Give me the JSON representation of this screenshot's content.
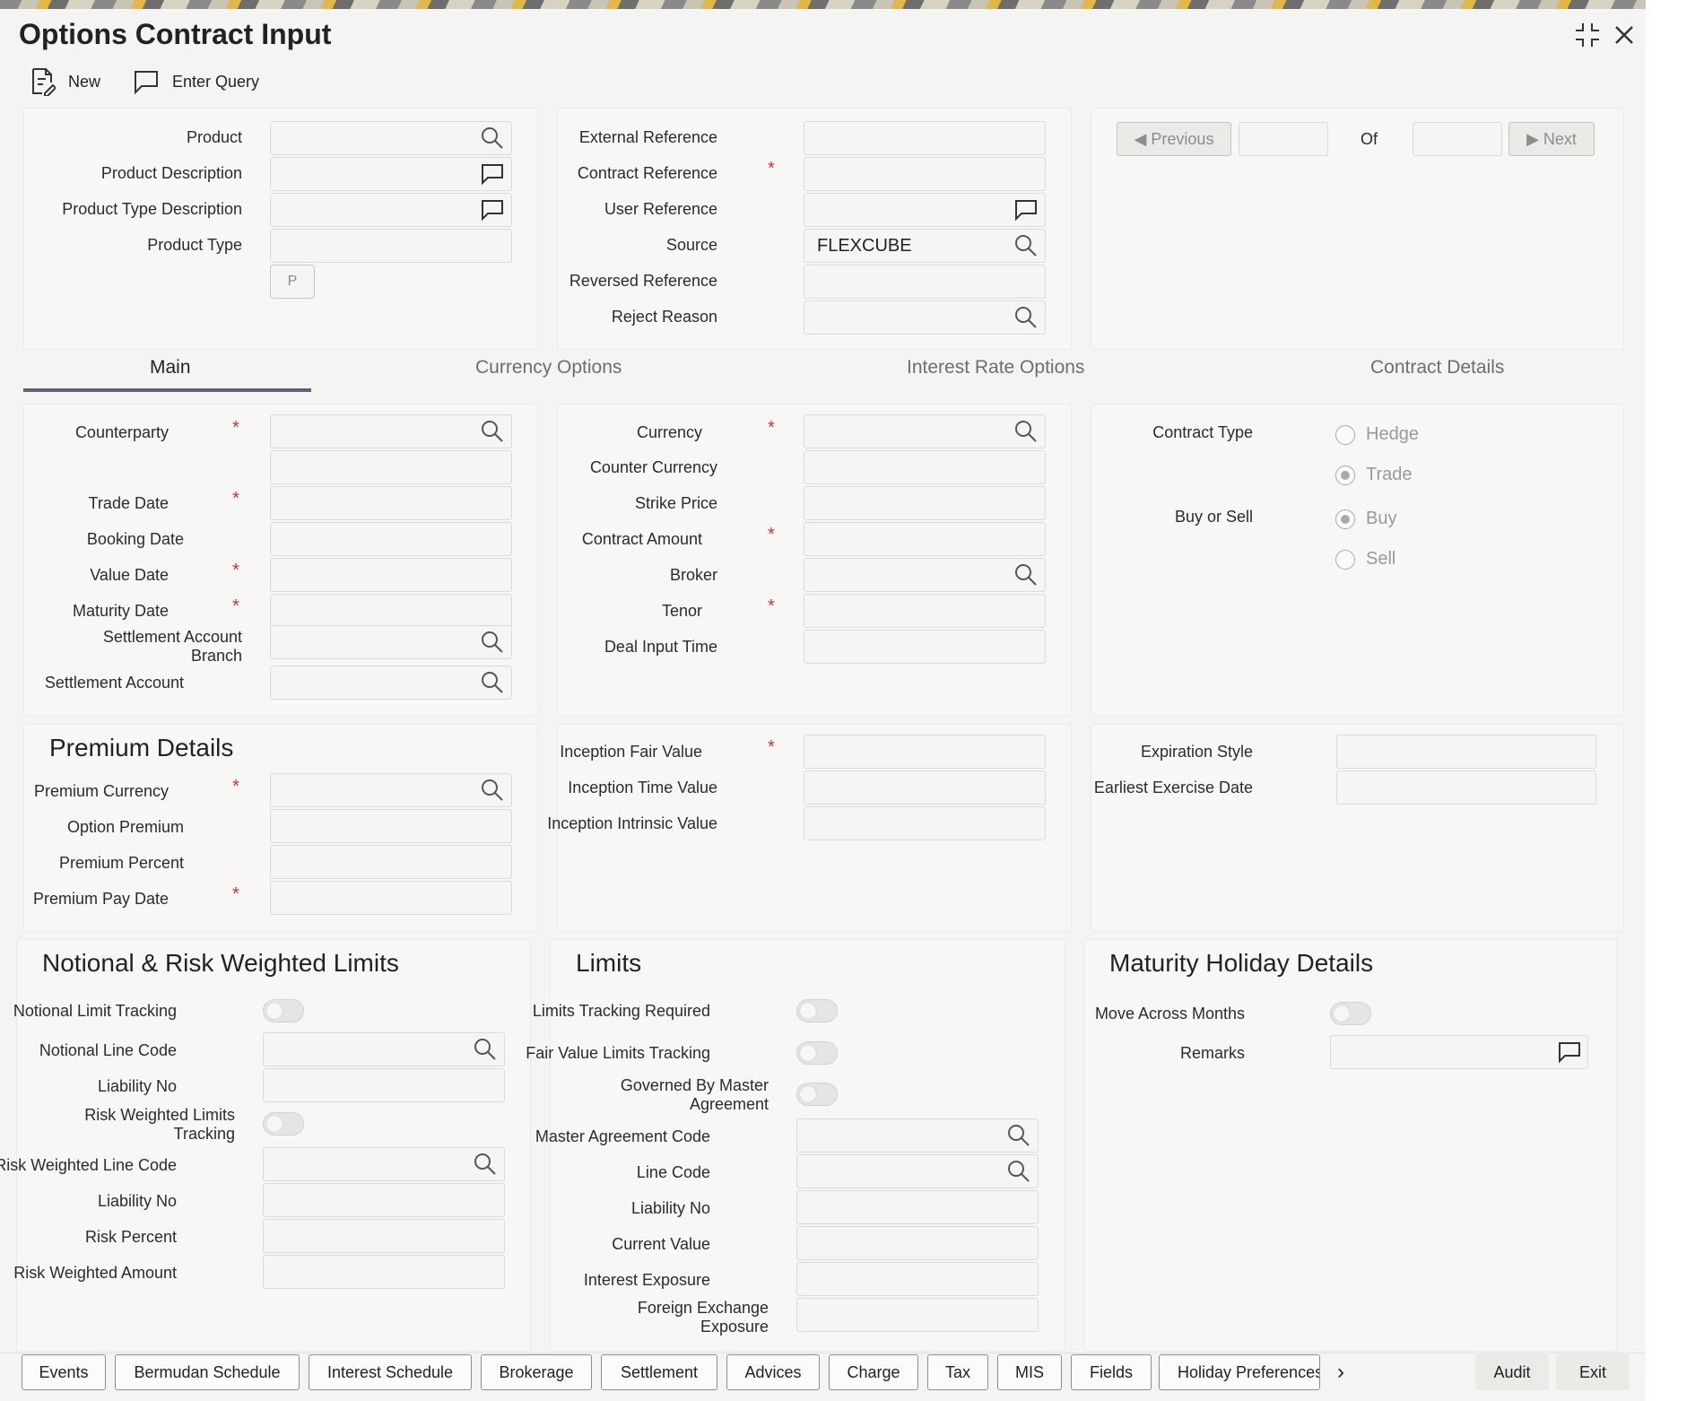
{
  "window": {
    "title": "Options Contract Input"
  },
  "toolbar": {
    "new_label": "New",
    "enter_query_label": "Enter Query"
  },
  "header": {
    "product_label": "Product",
    "product_description_label": "Product Description",
    "product_type_description_label": "Product Type Description",
    "product_type_label": "Product Type",
    "p_button": "P",
    "external_reference_label": "External Reference",
    "contract_reference_label": "Contract Reference",
    "user_reference_label": "User Reference",
    "source_label": "Source",
    "source_value": "FLEXCUBE",
    "reversed_reference_label": "Reversed Reference",
    "reject_reason_label": "Reject Reason"
  },
  "navigation": {
    "previous_label": "Previous",
    "of_label": "Of",
    "next_label": "Next"
  },
  "tabs": [
    {
      "label": "Main"
    },
    {
      "label": "Currency Options"
    },
    {
      "label": "Interest Rate Options"
    },
    {
      "label": "Contract Details"
    }
  ],
  "main": {
    "counterparty_label": "Counterparty",
    "trade_date_label": "Trade Date",
    "booking_date_label": "Booking Date",
    "value_date_label": "Value Date",
    "maturity_date_label": "Maturity Date",
    "settlement_account_branch_label": "Settlement Account Branch",
    "settlement_account_label": "Settlement Account",
    "currency_label": "Currency",
    "counter_currency_label": "Counter Currency",
    "strike_price_label": "Strike Price",
    "contract_amount_label": "Contract Amount",
    "broker_label": "Broker",
    "tenor_label": "Tenor",
    "deal_input_time_label": "Deal Input Time",
    "contract_type_label": "Contract Type",
    "contract_type_options": [
      "Hedge",
      "Trade"
    ],
    "contract_type_selected": "Trade",
    "buy_or_sell_label": "Buy or Sell",
    "buy_or_sell_options": [
      "Buy",
      "Sell"
    ],
    "buy_or_sell_selected": "Buy"
  },
  "premium": {
    "title": "Premium Details",
    "premium_currency_label": "Premium Currency",
    "option_premium_label": "Option Premium",
    "premium_percent_label": "Premium Percent",
    "premium_pay_date_label": "Premium Pay Date",
    "inception_fair_value_label": "Inception Fair Value",
    "inception_time_value_label": "Inception Time Value",
    "inception_intrinsic_value_label": "Inception Intrinsic Value",
    "expiration_style_label": "Expiration Style",
    "earliest_exercise_date_label": "Earliest Exercise Date"
  },
  "notional": {
    "title": "Notional & Risk Weighted Limits",
    "notional_limit_tracking_label": "Notional Limit Tracking",
    "notional_line_code_label": "Notional Line Code",
    "liability_no_label": "Liability No",
    "risk_weighted_limits_tracking_label": "Risk Weighted Limits Tracking",
    "risk_weighted_line_code_label": "Risk Weighted Line Code",
    "liability_no_2_label": "Liability No",
    "risk_percent_label": "Risk Percent",
    "risk_weighted_amount_label": "Risk Weighted Amount"
  },
  "limits": {
    "title": "Limits",
    "limits_tracking_required_label": "Limits Tracking Required",
    "fair_value_limits_tracking_label": "Fair Value Limits Tracking",
    "governed_by_master_agreement_label": "Governed By Master Agreement",
    "master_agreement_code_label": "Master Agreement Code",
    "line_code_label": "Line Code",
    "liability_no_label": "Liability No",
    "current_value_label": "Current Value",
    "interest_exposure_label": "Interest Exposure",
    "foreign_exchange_exposure_label": "Foreign Exchange Exposure"
  },
  "maturity_holiday": {
    "title": "Maturity Holiday Details",
    "move_across_months_label": "Move Across Months",
    "remarks_label": "Remarks"
  },
  "bottom_bar": {
    "buttons": [
      "Events",
      "Bermudan Schedule",
      "Interest Schedule",
      "Brokerage",
      "Settlement",
      "Advices",
      "Charge",
      "Tax",
      "MIS",
      "Fields",
      "Holiday Preferences"
    ],
    "audit_label": "Audit",
    "exit_label": "Exit"
  },
  "colors": {
    "required_marker": "#d0312d",
    "tab_underline": "#5a6478",
    "panel_background": "#f8f7f6"
  }
}
